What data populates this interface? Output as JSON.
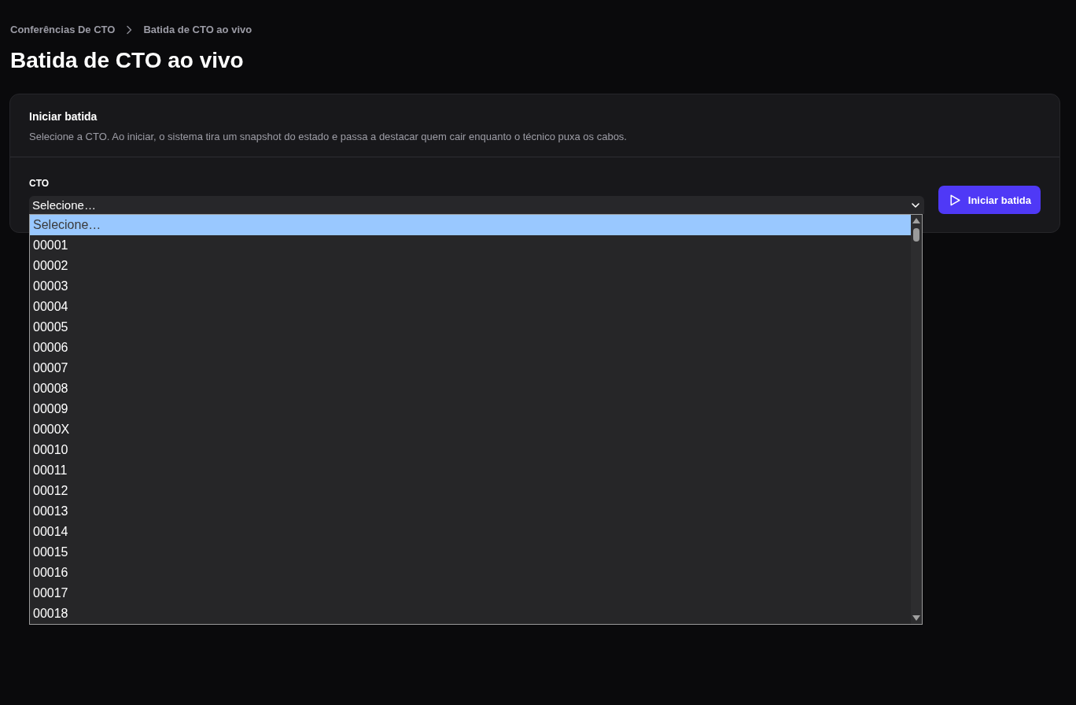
{
  "breadcrumb": [
    {
      "label": "Conferências De CTO"
    },
    {
      "label": "Batida de CTO ao vivo"
    }
  ],
  "title": "Batida de CTO ao vivo",
  "card": {
    "title": "Iniciar batida",
    "description": "Selecione a CTO. Ao iniciar, o sistema tira um snapshot do estado e passa a destacar quem cair enquanto o técnico puxa os cabos.",
    "field": {
      "label": "CTO",
      "value": "Selecione…",
      "expanded": true,
      "options": [
        {
          "label": "Selecione…",
          "selected": true
        },
        {
          "label": "00001",
          "selected": false
        },
        {
          "label": "00002",
          "selected": false
        },
        {
          "label": "00003",
          "selected": false
        },
        {
          "label": "00004",
          "selected": false
        },
        {
          "label": "00005",
          "selected": false
        },
        {
          "label": "00006",
          "selected": false
        },
        {
          "label": "00007",
          "selected": false
        },
        {
          "label": "00008",
          "selected": false
        },
        {
          "label": "00009",
          "selected": false
        },
        {
          "label": "0000X",
          "selected": false
        },
        {
          "label": "00010",
          "selected": false
        },
        {
          "label": "00011",
          "selected": false
        },
        {
          "label": "00012",
          "selected": false
        },
        {
          "label": "00013",
          "selected": false
        },
        {
          "label": "00014",
          "selected": false
        },
        {
          "label": "00015",
          "selected": false
        },
        {
          "label": "00016",
          "selected": false
        },
        {
          "label": "00017",
          "selected": false
        },
        {
          "label": "00018",
          "selected": false
        }
      ]
    },
    "button": "Iniciar batida"
  }
}
